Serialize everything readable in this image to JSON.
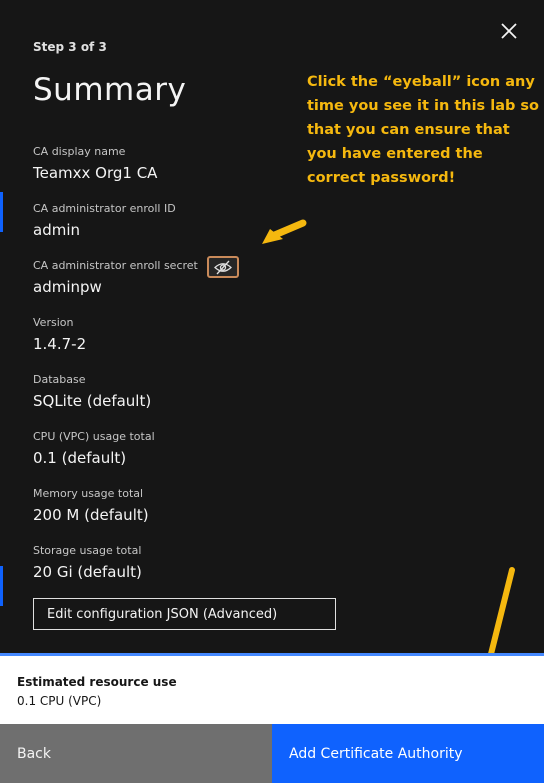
{
  "header": {
    "step": "Step 3 of 3",
    "title": "Summary",
    "close_icon": "close-icon"
  },
  "fields": [
    {
      "label": "CA display name",
      "value": "Teamxx Org1 CA"
    },
    {
      "label": "CA administrator enroll ID",
      "value": "admin"
    },
    {
      "label": "CA administrator enroll secret",
      "value": "adminpw",
      "icon": "eye-off-icon"
    },
    {
      "label": "Version",
      "value": "1.4.7-2"
    },
    {
      "label": "Database",
      "value": "SQLite (default)"
    },
    {
      "label": "CPU (VPC) usage total",
      "value": "0.1 (default)"
    },
    {
      "label": "Memory usage total",
      "value": "200 M (default)"
    },
    {
      "label": "Storage usage total",
      "value": "20 Gi (default)"
    }
  ],
  "edit_config_button": "Edit configuration JSON (Advanced)",
  "callout": {
    "text": "Click the “eyeball” icon any time you see it in this lab so that you can ensure that you have entered the correct password!",
    "color": "#f5b80f"
  },
  "resource": {
    "title": "Estimated resource use",
    "value": "0.1 CPU (VPC)"
  },
  "footer": {
    "back": "Back",
    "add": "Add Certificate Authority"
  },
  "colors": {
    "panel_bg": "#161616",
    "primary": "#0f62fe",
    "secondary": "#6f6f6f",
    "highlight_border": "#c98a5a"
  }
}
